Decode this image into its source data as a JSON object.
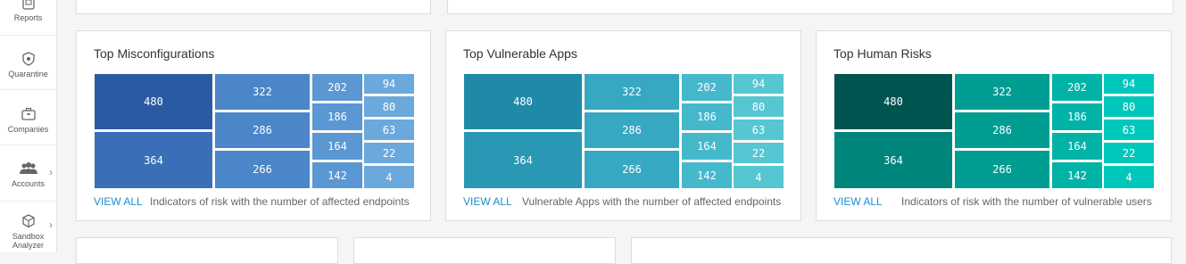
{
  "sidebar": {
    "items": [
      {
        "label": "Reports",
        "icon": "reports-icon"
      },
      {
        "label": "Quarantine",
        "icon": "quarantine-icon"
      },
      {
        "label": "Companies",
        "icon": "companies-icon"
      },
      {
        "label": "Accounts",
        "icon": "accounts-icon"
      },
      {
        "label": "Sandbox Analyzer",
        "icon": "sandbox-icon"
      }
    ],
    "expand_glyph": "›"
  },
  "cards": [
    {
      "title": "Top Misconfigurations",
      "view_all": "VIEW ALL",
      "description": "Indicators of risk with the number of affected endpoints",
      "colors": {
        "c1": "#2b5aa5",
        "c2": "#3a6fb8",
        "c3": "#4a86c8",
        "c4": "#5a97d3",
        "c5": "#6ba8dc"
      },
      "values": [
        "480",
        "364",
        "322",
        "286",
        "266",
        "202",
        "186",
        "164",
        "142",
        "94",
        "80",
        "63",
        "22",
        "4"
      ]
    },
    {
      "title": "Top Vulnerable Apps",
      "view_all": "VIEW ALL",
      "description": "Vulnerable Apps with the number of affected endpoints",
      "colors": {
        "c1": "#1f8aa8",
        "c2": "#2a98b5",
        "c3": "#37a8c2",
        "c4": "#45b8cc",
        "c5": "#55c6d2"
      },
      "values": [
        "480",
        "364",
        "322",
        "286",
        "266",
        "202",
        "186",
        "164",
        "142",
        "94",
        "80",
        "63",
        "22",
        "4"
      ]
    },
    {
      "title": "Top Human Risks",
      "view_all": "VIEW ALL",
      "description": "Indicators of risk with the number of vulnerable users",
      "colors": {
        "c1": "#005450",
        "c2": "#00857d",
        "c3": "#009d93",
        "c4": "#00b3a7",
        "c5": "#00c7bb"
      },
      "values": [
        "480",
        "364",
        "322",
        "286",
        "266",
        "202",
        "186",
        "164",
        "142",
        "94",
        "80",
        "63",
        "22",
        "4"
      ]
    }
  ]
}
